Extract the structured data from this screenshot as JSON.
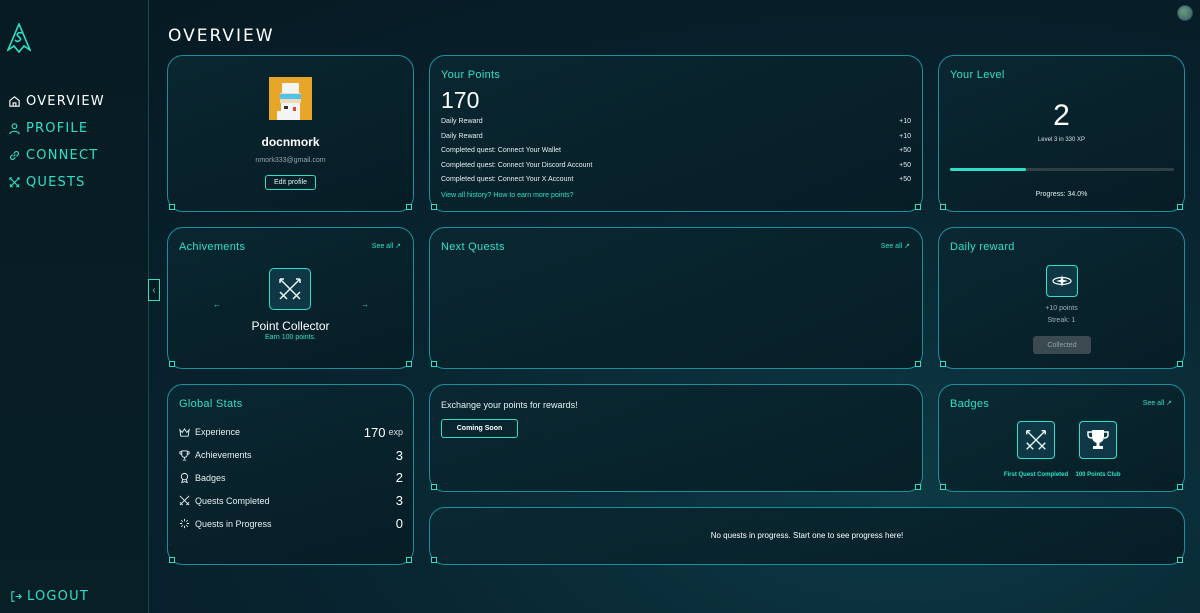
{
  "sidebar": {
    "items": [
      {
        "label": "OVERVIEW",
        "icon": "home-icon",
        "active": true
      },
      {
        "label": "PROFILE",
        "icon": "user-icon",
        "active": false
      },
      {
        "label": "CONNECT",
        "icon": "link-icon",
        "active": false
      },
      {
        "label": "QUESTS",
        "icon": "swords-icon",
        "active": false
      }
    ],
    "logout_label": "LOGOUT"
  },
  "page": {
    "title": "OVERVIEW"
  },
  "profile": {
    "username": "docnmork",
    "email": "nmork333@gmail.com",
    "edit_label": "Edit profile"
  },
  "points": {
    "title": "Your Points",
    "total": "170",
    "history": [
      {
        "label": "Daily Reward",
        "value": "+10"
      },
      {
        "label": "Daily Reward",
        "value": "+10"
      },
      {
        "label": "Completed quest: Connect Your Wallet",
        "value": "+50"
      },
      {
        "label": "Completed quest: Connect Your Discord Account",
        "value": "+50"
      },
      {
        "label": "Completed quest: Connect Your X Account",
        "value": "+50"
      }
    ],
    "links": "View all history? How to earn more points?"
  },
  "level": {
    "title": "Your Level",
    "number": "2",
    "subtitle": "Level 3 in 330 XP",
    "progress_fraction": 0.34,
    "progress_label": "Progress: 34.0%"
  },
  "achievements": {
    "title": "Achivements",
    "see_all": "See all ↗",
    "current_name": "Point Collector",
    "current_desc": "Earn 100 points.",
    "prev": "←",
    "next": "→"
  },
  "next_quests": {
    "title": "Next Quests",
    "see_all": "See all ↗"
  },
  "daily_reward": {
    "title": "Daily reward",
    "points": "+10 points",
    "streak": "Streak: 1",
    "button": "Collected"
  },
  "global_stats": {
    "title": "Global Stats",
    "rows": [
      {
        "label": "Experience",
        "value": "170",
        "unit": "exp",
        "icon": "crown-icon"
      },
      {
        "label": "Achievements",
        "value": "3",
        "unit": "",
        "icon": "trophy-icon"
      },
      {
        "label": "Badges",
        "value": "2",
        "unit": "",
        "icon": "medal-icon"
      },
      {
        "label": "Quests Completed",
        "value": "3",
        "unit": "",
        "icon": "swords-icon"
      },
      {
        "label": "Quests in Progress",
        "value": "0",
        "unit": "",
        "icon": "loader-icon"
      }
    ]
  },
  "exchange": {
    "text": "Exchange your points for rewards!",
    "button": "Coming Soon"
  },
  "badges": {
    "title": "Badges",
    "see_all": "See all ↗",
    "items": [
      {
        "label": "First Quest Completed",
        "icon": "swords-icon"
      },
      {
        "label": "100 Points Club",
        "icon": "trophy-icon"
      }
    ]
  },
  "quests_progress": {
    "empty_text": "No quests in progress. Start one to see progress here!"
  },
  "colors": {
    "accent": "#2fe0c8",
    "border": "#1c8f9e",
    "background": "#082430"
  }
}
